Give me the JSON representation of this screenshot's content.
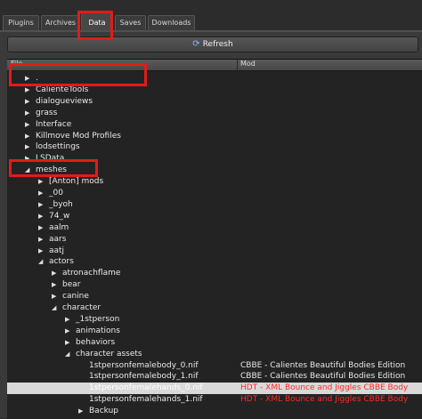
{
  "tabs": [
    "Plugins",
    "Archives",
    "Data",
    "Saves",
    "Downloads"
  ],
  "active_tab": "Data",
  "refresh_label": "Refresh",
  "columns": {
    "name": "File",
    "mod": "Mod"
  },
  "rows": [
    {
      "label": ".",
      "mod": "",
      "level": 0,
      "arrow": "collapsed"
    },
    {
      "label": "CalienteTools",
      "mod": "",
      "level": 0,
      "arrow": "collapsed"
    },
    {
      "label": "dialogueviews",
      "mod": "",
      "level": 0,
      "arrow": "collapsed"
    },
    {
      "label": "grass",
      "mod": "",
      "level": 0,
      "arrow": "collapsed"
    },
    {
      "label": "Interface",
      "mod": "",
      "level": 0,
      "arrow": "collapsed"
    },
    {
      "label": "Killmove Mod Profiles",
      "mod": "",
      "level": 0,
      "arrow": "collapsed"
    },
    {
      "label": "lodsettings",
      "mod": "",
      "level": 0,
      "arrow": "collapsed"
    },
    {
      "label": "LSData",
      "mod": "",
      "level": 0,
      "arrow": "collapsed"
    },
    {
      "label": "meshes",
      "mod": "",
      "level": 0,
      "arrow": "expanded"
    },
    {
      "label": "[Anton] mods",
      "mod": "",
      "level": 1,
      "arrow": "collapsed"
    },
    {
      "label": "_00",
      "mod": "",
      "level": 1,
      "arrow": "collapsed"
    },
    {
      "label": "_byoh",
      "mod": "",
      "level": 1,
      "arrow": "collapsed"
    },
    {
      "label": "74_w",
      "mod": "",
      "level": 1,
      "arrow": "collapsed"
    },
    {
      "label": "aalm",
      "mod": "",
      "level": 1,
      "arrow": "collapsed"
    },
    {
      "label": "aars",
      "mod": "",
      "level": 1,
      "arrow": "collapsed"
    },
    {
      "label": "aatj",
      "mod": "",
      "level": 1,
      "arrow": "collapsed"
    },
    {
      "label": "actors",
      "mod": "",
      "level": 1,
      "arrow": "expanded"
    },
    {
      "label": "atronachflame",
      "mod": "",
      "level": 2,
      "arrow": "collapsed"
    },
    {
      "label": "bear",
      "mod": "",
      "level": 2,
      "arrow": "collapsed"
    },
    {
      "label": "canine",
      "mod": "",
      "level": 2,
      "arrow": "collapsed"
    },
    {
      "label": "character",
      "mod": "",
      "level": 2,
      "arrow": "expanded"
    },
    {
      "label": "_1stperson",
      "mod": "",
      "level": 3,
      "arrow": "collapsed"
    },
    {
      "label": "animations",
      "mod": "",
      "level": 3,
      "arrow": "collapsed"
    },
    {
      "label": "behaviors",
      "mod": "",
      "level": 3,
      "arrow": "collapsed"
    },
    {
      "label": "character assets",
      "mod": "",
      "level": 3,
      "arrow": "expanded"
    },
    {
      "label": "1stpersonfemalebody_0.nif",
      "mod": "CBBE - Calientes Beautiful Bodies Edition",
      "level": 4,
      "arrow": "none",
      "mod_color": "normal"
    },
    {
      "label": "1stpersonfemalebody_1.nif",
      "mod": "CBBE - Calientes Beautiful Bodies Edition",
      "level": 4,
      "arrow": "none",
      "mod_color": "normal"
    },
    {
      "label": "1stpersonfemalehands_0.nif",
      "mod": "HDT - XML Bounce and Jiggles CBBE Body",
      "level": 4,
      "arrow": "none",
      "mod_color": "red",
      "selected": true
    },
    {
      "label": "1stpersonfemalehands_1.nif",
      "mod": "HDT - XML Bounce and Jiggles CBBE Body",
      "level": 4,
      "arrow": "none",
      "mod_color": "red"
    },
    {
      "label": "Backup",
      "mod": "",
      "level": 4,
      "arrow": "collapsed"
    }
  ],
  "colors": {
    "highlight_box": "#e11b1b",
    "conflict_text": "#ff2a2a",
    "selection": "#d9d9d9"
  }
}
